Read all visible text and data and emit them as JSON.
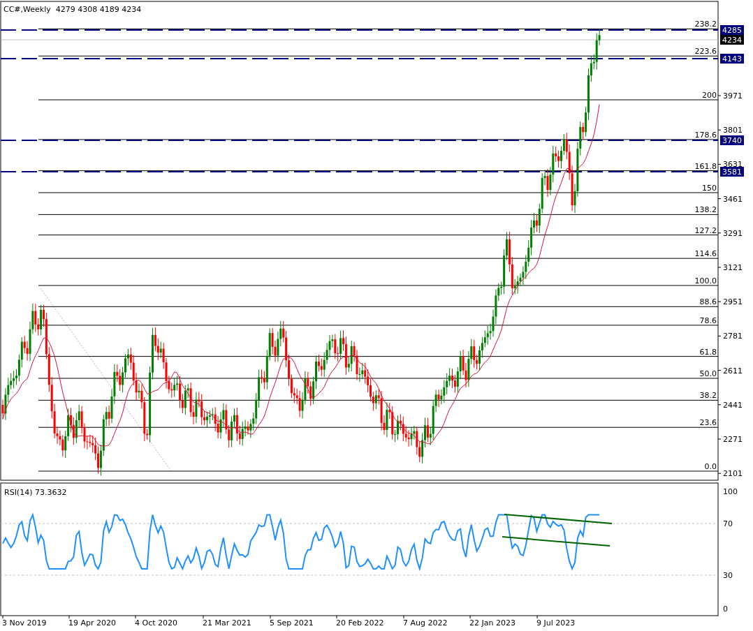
{
  "header": {
    "symbol": "CC#,Weekly",
    "ohlc": [
      "4279",
      "4308",
      "4189",
      "4234"
    ]
  },
  "price_axis": [
    "3971",
    "3801",
    "3631",
    "3461",
    "3291",
    "3121",
    "2951",
    "2781",
    "2611",
    "2441",
    "2271",
    "2101"
  ],
  "fib_levels": [
    {
      "label": "238.2"
    },
    {
      "label": "223.6"
    },
    {
      "label": "200"
    },
    {
      "label": "178.6"
    },
    {
      "label": "161.8"
    },
    {
      "label": "150"
    },
    {
      "label": "138.2"
    },
    {
      "label": "127.2"
    },
    {
      "label": "114.6"
    },
    {
      "label": "100.0"
    },
    {
      "label": "88.6"
    },
    {
      "label": "78.6"
    },
    {
      "label": "61.8"
    },
    {
      "label": "50.0"
    },
    {
      "label": "38.2"
    },
    {
      "label": "23.6"
    },
    {
      "label": "0.0"
    }
  ],
  "horizontal_lines": [
    {
      "price": "4285"
    },
    {
      "price": "4143"
    },
    {
      "price": "3740"
    },
    {
      "price": "3581"
    }
  ],
  "current_price": "4234",
  "rsi": {
    "label": "RSI(14) 73.3632",
    "ticks": [
      "100",
      "70",
      "30",
      "0"
    ]
  },
  "time_axis": [
    "3 Nov 2019",
    "19 Apr 2020",
    "4 Oct 2020",
    "21 Mar 2021",
    "5 Sep 2021",
    "20 Feb 2022",
    "7 Aug 2022",
    "22 Jan 2023",
    "9 Jul 2023"
  ]
}
